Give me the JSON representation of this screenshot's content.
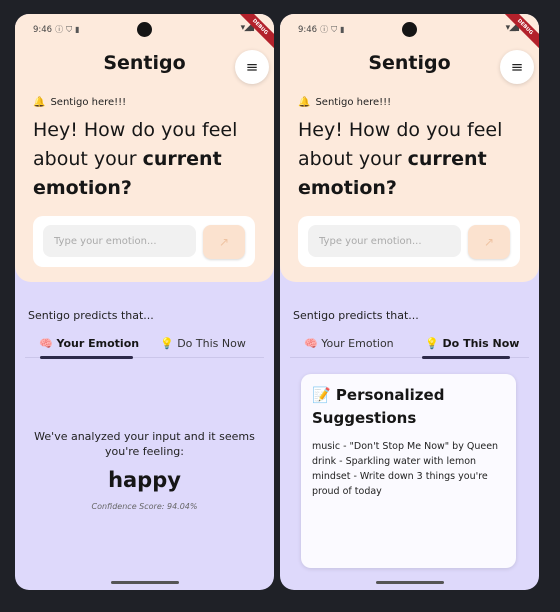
{
  "status_bar": {
    "time": "9:46",
    "debug_label": "DEBUG"
  },
  "app": {
    "title": "Sentigo"
  },
  "header": {
    "greeting": "Sentigo here!!!",
    "question_prefix": "Hey! How do you feel about your ",
    "question_bold": "current emotion?"
  },
  "input": {
    "placeholder": "Type your emotion...",
    "value": ""
  },
  "send_icon": "↗",
  "predicts_label": "Sentigo predicts that...",
  "tabs": [
    {
      "icon": "🧠",
      "label": "Your Emotion"
    },
    {
      "icon": "💡",
      "label": "Do This Now"
    }
  ],
  "emotion_view": {
    "analysis": "We've analyzed your input and it seems you're feeling:",
    "emotion": "happy",
    "confidence": "Confidence Score: 94.04%"
  },
  "suggestions_view": {
    "title_icon": "📝",
    "title": "Personalized Suggestions",
    "items": [
      "music - \"Don't Stop Me Now\" by Queen",
      "drink - Sparkling water with lemon",
      "mindset - Write down 3 things you're proud of today"
    ]
  },
  "colors": {
    "top_bg": "#fdeadc",
    "bottom_bg": "#ded9fb",
    "indicator": "#2d2a4a",
    "debug_banner": "#b3212b"
  }
}
